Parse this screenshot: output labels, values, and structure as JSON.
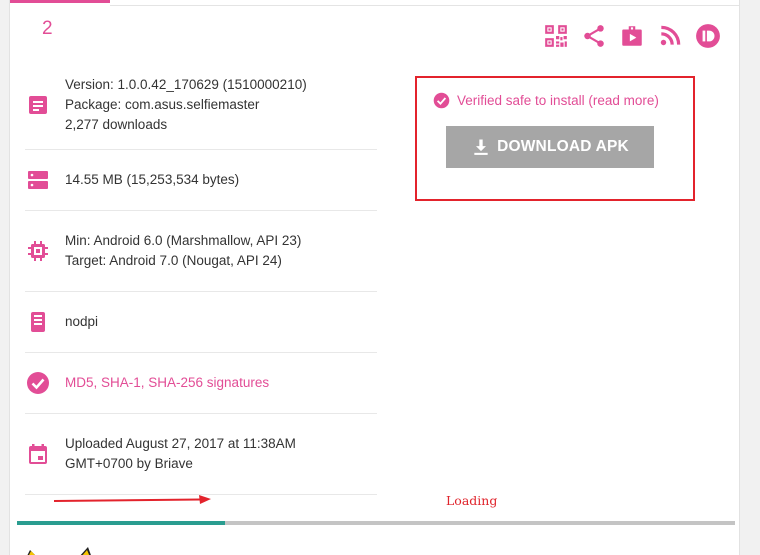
{
  "tab": {
    "number": "2"
  },
  "share_icons": [
    "qr-code-icon",
    "share-icon",
    "play-store-icon",
    "rss-icon",
    "pushbullet-icon"
  ],
  "details": {
    "version": {
      "line1": "Version: 1.0.0.42_170629 (1510000210)",
      "line2": "Package: com.asus.selfiemaster",
      "line3": "2,277 downloads"
    },
    "size": "14.55 MB (15,253,534 bytes)",
    "sdk": {
      "min": "Min: Android 6.0 (Marshmallow, API 23)",
      "target": "Target: Android 7.0 (Nougat, API 24)"
    },
    "dpi": "nodpi",
    "signatures": "MD5, SHA-1, SHA-256 signatures",
    "uploaded": {
      "line1": "Uploaded August 27, 2017 at 11:38AM",
      "line2": "GMT+0700 by Briave"
    }
  },
  "download": {
    "verified_text": "Verified safe to install (read more)",
    "button_label": "DOWNLOAD APK"
  },
  "annotation": {
    "loading_text": "Loading"
  },
  "progress": {
    "fraction": 0.29
  },
  "colors": {
    "accent": "#e24d96",
    "annotation_red": "#e3232c",
    "progress": "#2a9d90",
    "button_disabled": "#a6a6a6"
  }
}
